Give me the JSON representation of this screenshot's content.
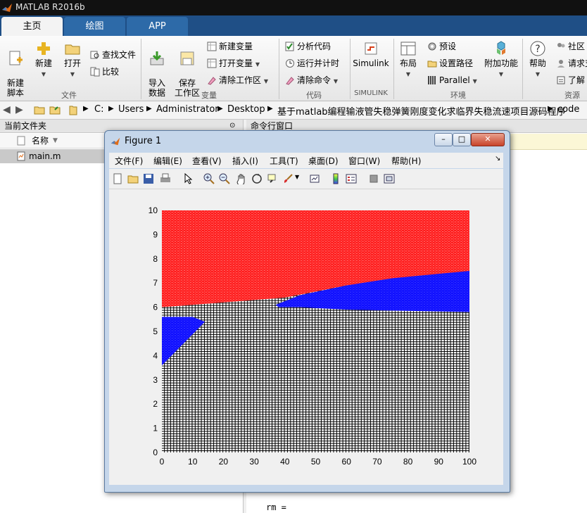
{
  "app": {
    "title": "MATLAB R2016b"
  },
  "tabs": [
    {
      "label": "主页"
    },
    {
      "label": "绘图"
    },
    {
      "label": "APP"
    }
  ],
  "ribbon": {
    "file": {
      "new_script": "新建\n脚本",
      "new": "新建",
      "open": "打开",
      "find_files": "查找文件",
      "compare": "比较",
      "group": "文件"
    },
    "variable": {
      "import": "导入\n数据",
      "save_ws": "保存\n工作区",
      "new_var": "新建变量",
      "open_var": "打开变量",
      "clear_ws": "清除工作区",
      "group": "变量"
    },
    "code": {
      "analyze": "分析代码",
      "run_time": "运行并计时",
      "clear_cmd": "清除命令",
      "group": "代码"
    },
    "simulink": {
      "simulink": "Simulink",
      "group": "SIMULINK"
    },
    "env": {
      "layout": "布局",
      "prefs": "预设",
      "set_path": "设置路径",
      "parallel": "Parallel",
      "addons": "附加功能",
      "group": "环境"
    },
    "resources": {
      "help": "帮助",
      "community": "社区",
      "request": "请求支",
      "learn": "了解",
      "group": "资源"
    }
  },
  "address": {
    "path": [
      "C:",
      "Users",
      "Administrator",
      "Desktop",
      "基于matlab编程输液管失稳弹簧刚度变化求临界失稳流速项目源码程序",
      "code"
    ]
  },
  "current_folder": {
    "title": "当前文件夹",
    "col_name": "名称",
    "files": [
      {
        "name": "main.m"
      }
    ]
  },
  "command_window": {
    "title": "命令行窗口",
    "output_last": "rm ="
  },
  "figure": {
    "title": "Figure 1",
    "menu": [
      "文件(F)",
      "编辑(E)",
      "查看(V)",
      "插入(I)",
      "工具(T)",
      "桌面(D)",
      "窗口(W)",
      "帮助(H)"
    ],
    "toolbar_icons": [
      "new-figure-icon",
      "open-file-icon",
      "save-icon",
      "print-icon",
      "pointer-icon",
      "zoom-in-icon",
      "zoom-out-icon",
      "pan-hand-icon",
      "rotate-3d-icon",
      "data-cursor-icon",
      "brush-icon",
      "link-plot-icon",
      "colorbar-icon",
      "legend-icon",
      "hide-plot-tools-icon",
      "show-plot-tools-icon"
    ]
  },
  "chart_data": {
    "type": "scatter",
    "x_range": [
      0,
      100
    ],
    "y_range": [
      0,
      10
    ],
    "xticks": [
      0,
      10,
      20,
      30,
      40,
      50,
      60,
      70,
      80,
      90,
      100
    ],
    "yticks": [
      0,
      1,
      2,
      3,
      4,
      5,
      6,
      7,
      8,
      9,
      10
    ],
    "grid_step": {
      "x": 1,
      "y": 0.1
    },
    "colors": {
      "red": "#ff0000",
      "blue": "#0000ff",
      "black": "#000000"
    },
    "regions": {
      "red_lower_boundary": [
        [
          0,
          6.0
        ],
        [
          40,
          6.4
        ],
        [
          60,
          6.9
        ],
        [
          100,
          7.5
        ]
      ],
      "blue_lobe_right": [
        [
          37,
          6.1
        ],
        [
          45,
          6.5
        ],
        [
          60,
          6.9
        ],
        [
          75,
          7.2
        ],
        [
          100,
          7.5
        ],
        [
          100,
          5.8
        ],
        [
          60,
          5.9
        ],
        [
          45,
          6.0
        ],
        [
          38,
          6.0
        ]
      ],
      "blue_lobe_left": [
        [
          0,
          5.6
        ],
        [
          10,
          5.6
        ],
        [
          14,
          5.4
        ],
        [
          0,
          3.6
        ]
      ]
    }
  }
}
